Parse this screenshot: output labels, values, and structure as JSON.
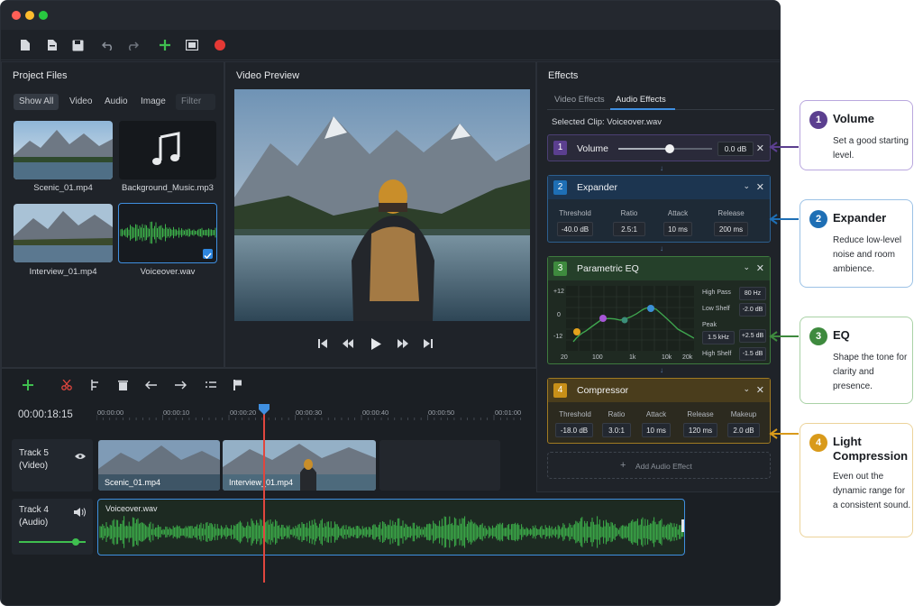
{
  "toolbar": {
    "icons": [
      "new-file-icon",
      "open-file-icon",
      "save-icon",
      "undo-icon",
      "redo-icon",
      "add-icon",
      "export-icon",
      "record-icon"
    ]
  },
  "project_files": {
    "title": "Project Files",
    "tabs": [
      "Show All",
      "Video",
      "Audio",
      "Image"
    ],
    "filter_placeholder": "Filter",
    "items": [
      "Scenic_01.mp4",
      "Background_Music.mp3",
      "Interview_01.mp4",
      "Voiceover.wav"
    ]
  },
  "preview": {
    "title": "Video Preview"
  },
  "timeline": {
    "timecode": "00:00:18:15",
    "ticks": [
      "00:00:00",
      "00:00:10",
      "00:00:20",
      "00:00:30",
      "00:00:40",
      "00:00:50",
      "00:01:00"
    ],
    "tracks": [
      {
        "name": "Track 5",
        "kind": "(Video)"
      },
      {
        "name": "Track 4",
        "kind": "(Audio)"
      }
    ],
    "clips": {
      "video1": "Scenic_01.mp4",
      "video2": "Interview_01.mp4",
      "audio": "Voiceover.wav"
    },
    "audio_volume": 0.85
  },
  "effects": {
    "title": "Effects",
    "tabs": [
      "Video Effects",
      "Audio Effects"
    ],
    "selected_clip": "Selected Clip: Voiceover.wav",
    "volume": {
      "num": "1",
      "name": "Volume",
      "value": "0.0 dB",
      "level": 0.55
    },
    "expander": {
      "num": "2",
      "name": "Expander",
      "params": [
        {
          "label": "Threshold",
          "value": "-40.0 dB"
        },
        {
          "label": "Ratio",
          "value": "2.5:1"
        },
        {
          "label": "Attack",
          "value": "10 ms"
        },
        {
          "label": "Release",
          "value": "200 ms"
        }
      ]
    },
    "eq": {
      "num": "3",
      "name": "Parametric EQ",
      "y_labels": [
        "+12",
        "0",
        "-12"
      ],
      "x_labels": [
        "20",
        "100",
        "1k",
        "10k",
        "20k"
      ],
      "bands": [
        {
          "label": "High Pass",
          "value": "80 Hz"
        },
        {
          "label": "Low Shelf",
          "value": "-2.0 dB"
        },
        {
          "label": "Peak",
          "value": "1.5 kHz",
          "gain": "+2.5 dB"
        },
        {
          "label": "High Shelf",
          "value": "-1.5 dB"
        }
      ]
    },
    "compressor": {
      "num": "4",
      "name": "Compressor",
      "params": [
        {
          "label": "Threshold",
          "value": "-18.0 dB"
        },
        {
          "label": "Ratio",
          "value": "3.0:1"
        },
        {
          "label": "Attack",
          "value": "10 ms"
        },
        {
          "label": "Release",
          "value": "120 ms"
        },
        {
          "label": "Makeup",
          "value": "2.0 dB"
        }
      ]
    },
    "add_label": "Add Audio Effect"
  },
  "callouts": [
    {
      "num": "1",
      "title": "Volume",
      "desc": "Set a good starting level.",
      "color": "#5b3f8f"
    },
    {
      "num": "2",
      "title": "Expander",
      "desc": "Reduce low-level noise and room ambience.",
      "color": "#1e6fb5"
    },
    {
      "num": "3",
      "title": "EQ",
      "desc": "Shape the tone for clarity and presence.",
      "color": "#3e8a3e"
    },
    {
      "num": "4",
      "title": "Light Compression",
      "desc": "Even out the dynamic range for a consistent sound.",
      "color": "#d99a1a"
    }
  ]
}
